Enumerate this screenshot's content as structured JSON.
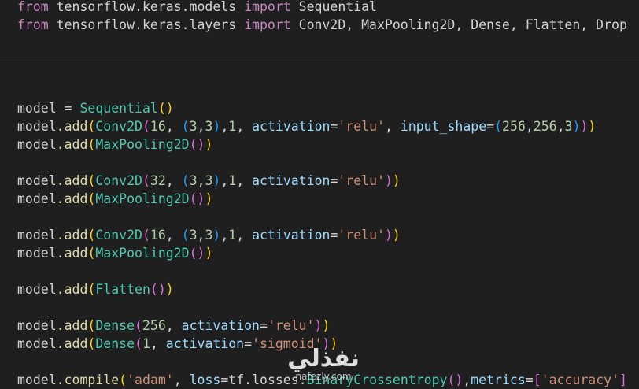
{
  "imports": [
    {
      "kw1": "from",
      "module": " tensorflow.keras.models ",
      "kw2": "import",
      "names": " Sequential"
    },
    {
      "kw1": "from",
      "module": " tensorflow.keras.layers ",
      "kw2": "import",
      "names": " Conv2D, MaxPooling2D, Dense, Flatten, Drop"
    }
  ],
  "code": {
    "model": "model",
    "eq": " = ",
    "sequential": "Sequential",
    "dot_add": ".add",
    "conv2d": "Conv2D",
    "maxpool": "MaxPooling2D",
    "flatten": "Flatten",
    "dense": "Dense",
    "compile": ".compile",
    "activation": "activation",
    "input_shape": "input_shape",
    "relu": "'relu'",
    "sigmoid": "'sigmoid'",
    "adam": "'adam'",
    "loss": "loss",
    "tf": "tf",
    "losses": ".losses.",
    "bce": "BinaryCrossentropy",
    "metrics": "metrics",
    "accuracy": "'accuracy'",
    "n16": "16",
    "n32": "32",
    "n256": "256",
    "n1": "1",
    "n3": "3"
  },
  "watermark": {
    "logo": "نفذلي",
    "sub": "nafezly.com"
  }
}
